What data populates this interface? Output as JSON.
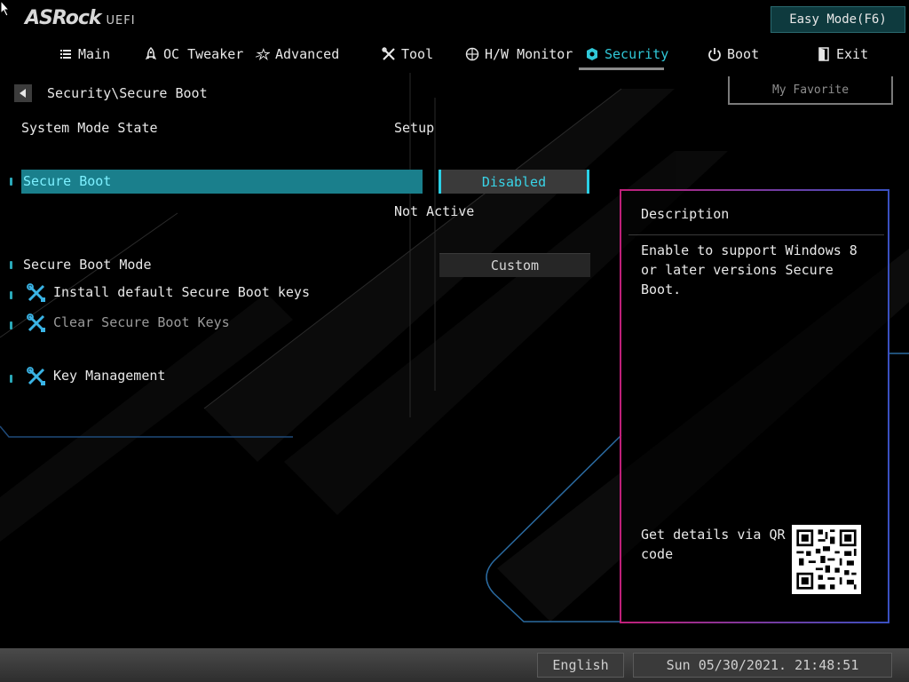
{
  "brand": {
    "name": "ASRock",
    "sub": "UEFI"
  },
  "easy_mode_label": "Easy Mode(F6)",
  "nav": {
    "tabs": [
      {
        "label": "Main",
        "icon": "list-icon"
      },
      {
        "label": "OC Tweaker",
        "icon": "rocket-icon"
      },
      {
        "label": "Advanced",
        "icon": "star-icon"
      },
      {
        "label": "Tool",
        "icon": "tools-icon"
      },
      {
        "label": "H/W Monitor",
        "icon": "monitor-icon"
      },
      {
        "label": "Security",
        "icon": "shield-icon",
        "active": true
      },
      {
        "label": "Boot",
        "icon": "power-icon"
      },
      {
        "label": "Exit",
        "icon": "exit-door-icon"
      }
    ]
  },
  "breadcrumb": "Security\\Secure Boot",
  "my_favorite_label": "My Favorite",
  "settings": {
    "system_mode_state": {
      "label": "System Mode State",
      "value": "Setup"
    },
    "secure_boot": {
      "label": "Secure Boot",
      "value": "Disabled",
      "status": "Not Active"
    },
    "secure_boot_mode": {
      "label": "Secure Boot Mode",
      "value": "Custom"
    },
    "install_default_keys": {
      "label": "Install default Secure Boot keys"
    },
    "clear_keys": {
      "label": "Clear Secure Boot Keys"
    },
    "key_management": {
      "label": "Key Management"
    }
  },
  "description": {
    "title": "Description",
    "text": "Enable to support Windows 8 or later versions Secure Boot.",
    "qr_text": "Get details via QR code"
  },
  "footer": {
    "language": "English",
    "datetime": "Sun 05/30/2021. 21:48:51"
  },
  "colors": {
    "accent": "#30c8d8",
    "selection": "#1a7f8c",
    "panel_border_start": "#c0207a",
    "panel_border_end": "#3a50c0"
  }
}
